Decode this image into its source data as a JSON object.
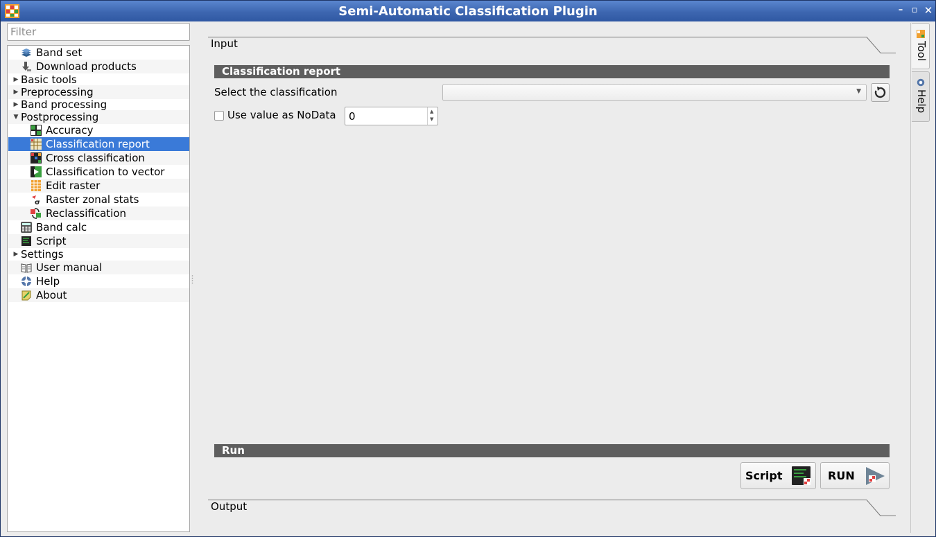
{
  "window": {
    "title": "Semi-Automatic Classification Plugin",
    "controls": {
      "minimize": "–",
      "maximize": "▫",
      "close": "✕"
    }
  },
  "filter": {
    "placeholder": "Filter",
    "value": ""
  },
  "tree": {
    "selected_color": "#3a7ad8",
    "items": [
      {
        "label": "Band set",
        "icon": "band-set-icon"
      },
      {
        "label": "Download products",
        "icon": "download-icon"
      },
      {
        "label": "Basic tools",
        "expandable": true,
        "expanded": false
      },
      {
        "label": "Preprocessing",
        "expandable": true,
        "expanded": false
      },
      {
        "label": "Band processing",
        "expandable": true,
        "expanded": false
      },
      {
        "label": "Postprocessing",
        "expandable": true,
        "expanded": true
      },
      {
        "label": "Accuracy",
        "icon": "accuracy-icon"
      },
      {
        "label": "Classification report",
        "icon": "classification-report-icon",
        "selected": true
      },
      {
        "label": "Cross classification",
        "icon": "cross-classification-icon"
      },
      {
        "label": "Classification to vector",
        "icon": "classification-to-vector-icon"
      },
      {
        "label": "Edit raster",
        "icon": "edit-raster-icon"
      },
      {
        "label": "Raster zonal stats",
        "icon": "zonal-stats-icon"
      },
      {
        "label": "Reclassification",
        "icon": "reclassification-icon"
      },
      {
        "label": "Band calc",
        "icon": "band-calc-icon"
      },
      {
        "label": "Script",
        "icon": "script-icon"
      },
      {
        "label": "Settings",
        "expandable": true,
        "expanded": false
      },
      {
        "label": "User manual",
        "icon": "user-manual-icon"
      },
      {
        "label": "Help",
        "icon": "help-icon"
      },
      {
        "label": "About",
        "icon": "about-icon"
      }
    ]
  },
  "main": {
    "input_group": "Input",
    "report_section": "Classification report",
    "select_label": "Select the classification",
    "classification_value": "",
    "nodata_label": "Use value as NoData",
    "nodata_checked": false,
    "nodata_value": "0",
    "run_section": "Run",
    "script_button": "Script",
    "run_button": "RUN",
    "output_group": "Output",
    "section_bar_color": "#5e5e5e"
  },
  "dock": {
    "tabs": [
      {
        "label": "Tool",
        "active": true
      },
      {
        "label": "Help",
        "active": false
      }
    ]
  }
}
